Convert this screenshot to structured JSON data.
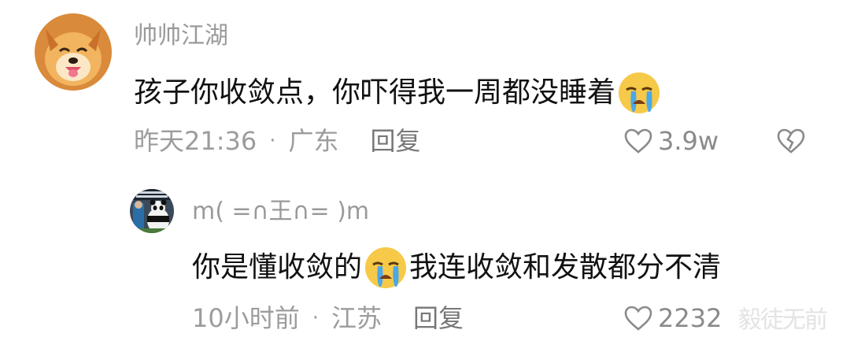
{
  "comment": {
    "username": "帅帅江湖",
    "text_before_emoji": "孩子你收敛点，你吓得我一周都没睡着",
    "emoji": "crying-face",
    "time": "昨天21:36",
    "location": "广东",
    "reply_label": "回复",
    "likes": "3.9w"
  },
  "reply": {
    "username": "m( =∩王∩= )m",
    "text_before_emoji": "你是懂收敛的",
    "emoji": "crying-face",
    "text_after_emoji": "我连收敛和发散都分不清",
    "time": "10小时前",
    "location": "江苏",
    "reply_label": "回复",
    "likes": "2232"
  },
  "separator": "·",
  "watermark": "毅徒无前",
  "colors": {
    "username": "#9a9a9a",
    "text": "#111111",
    "meta": "#9c9c9c",
    "emoji_face": "#f7c948",
    "emoji_tears": "#4aa8e8"
  }
}
